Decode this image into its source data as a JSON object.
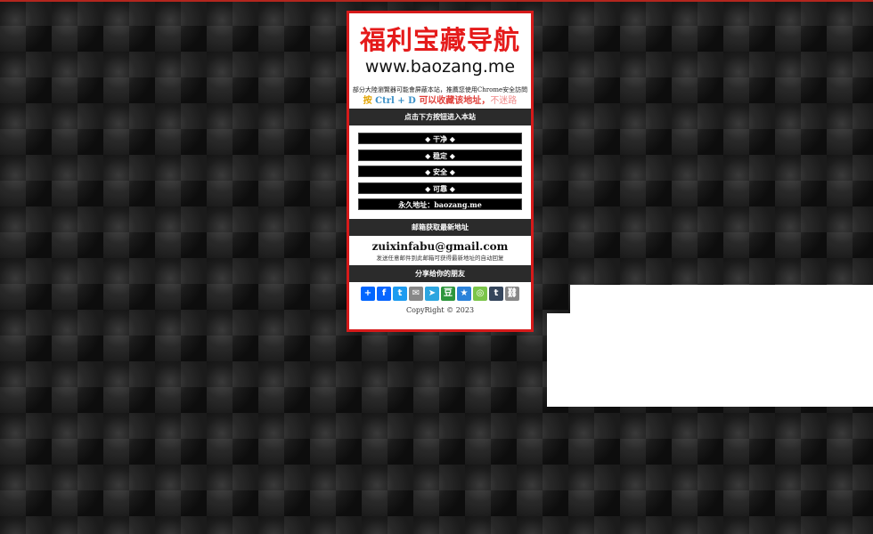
{
  "site": {
    "logo_title": "福利宝藏导航",
    "logo_domain": "www.baozang.me",
    "notice": "部分大陸瀏覽器可能會屏蔽本站，推薦您使用Chrome安全訪問",
    "bookmark": {
      "press": "按",
      "keys": "Ctrl + D",
      "mid": "可以收藏该地址，",
      "end": "不迷路"
    }
  },
  "sections": {
    "enter_heading": "点击下方按钮进入本站",
    "email_heading": "邮箱获取最新地址",
    "share_heading": "分享给你的朋友"
  },
  "buttons": [
    {
      "label": "◆ 干净 ◆"
    },
    {
      "label": "◆ 稳定 ◆"
    },
    {
      "label": "◆ 安全 ◆"
    },
    {
      "label": "◆ 可靠 ◆"
    },
    {
      "label": "永久地址：baozang.me"
    }
  ],
  "email": {
    "address": "zuixinfabu@gmail.com",
    "note": "发送任意邮件到此邮箱可获得最新地址的自动回复"
  },
  "share_icons": [
    {
      "name": "share-plus-icon",
      "glyph": "+",
      "color": "#0166ff"
    },
    {
      "name": "facebook-icon",
      "glyph": "f",
      "color": "#0866ff"
    },
    {
      "name": "twitter-icon",
      "glyph": "t",
      "color": "#1d9bf0"
    },
    {
      "name": "email-icon",
      "glyph": "✉",
      "color": "#888888"
    },
    {
      "name": "telegram-icon",
      "glyph": "➤",
      "color": "#2ca5e0"
    },
    {
      "name": "douban-icon",
      "glyph": "豆",
      "color": "#2e963d"
    },
    {
      "name": "qzone-icon",
      "glyph": "★",
      "color": "#2b82d9"
    },
    {
      "name": "wechat-icon",
      "glyph": "◎",
      "color": "#7bc549"
    },
    {
      "name": "tumblr-icon",
      "glyph": "t",
      "color": "#35465c"
    },
    {
      "name": "copy-link-icon",
      "glyph": "⛓",
      "color": "#888888"
    }
  ],
  "footer": {
    "copyright": "CopyRight © 2023"
  }
}
